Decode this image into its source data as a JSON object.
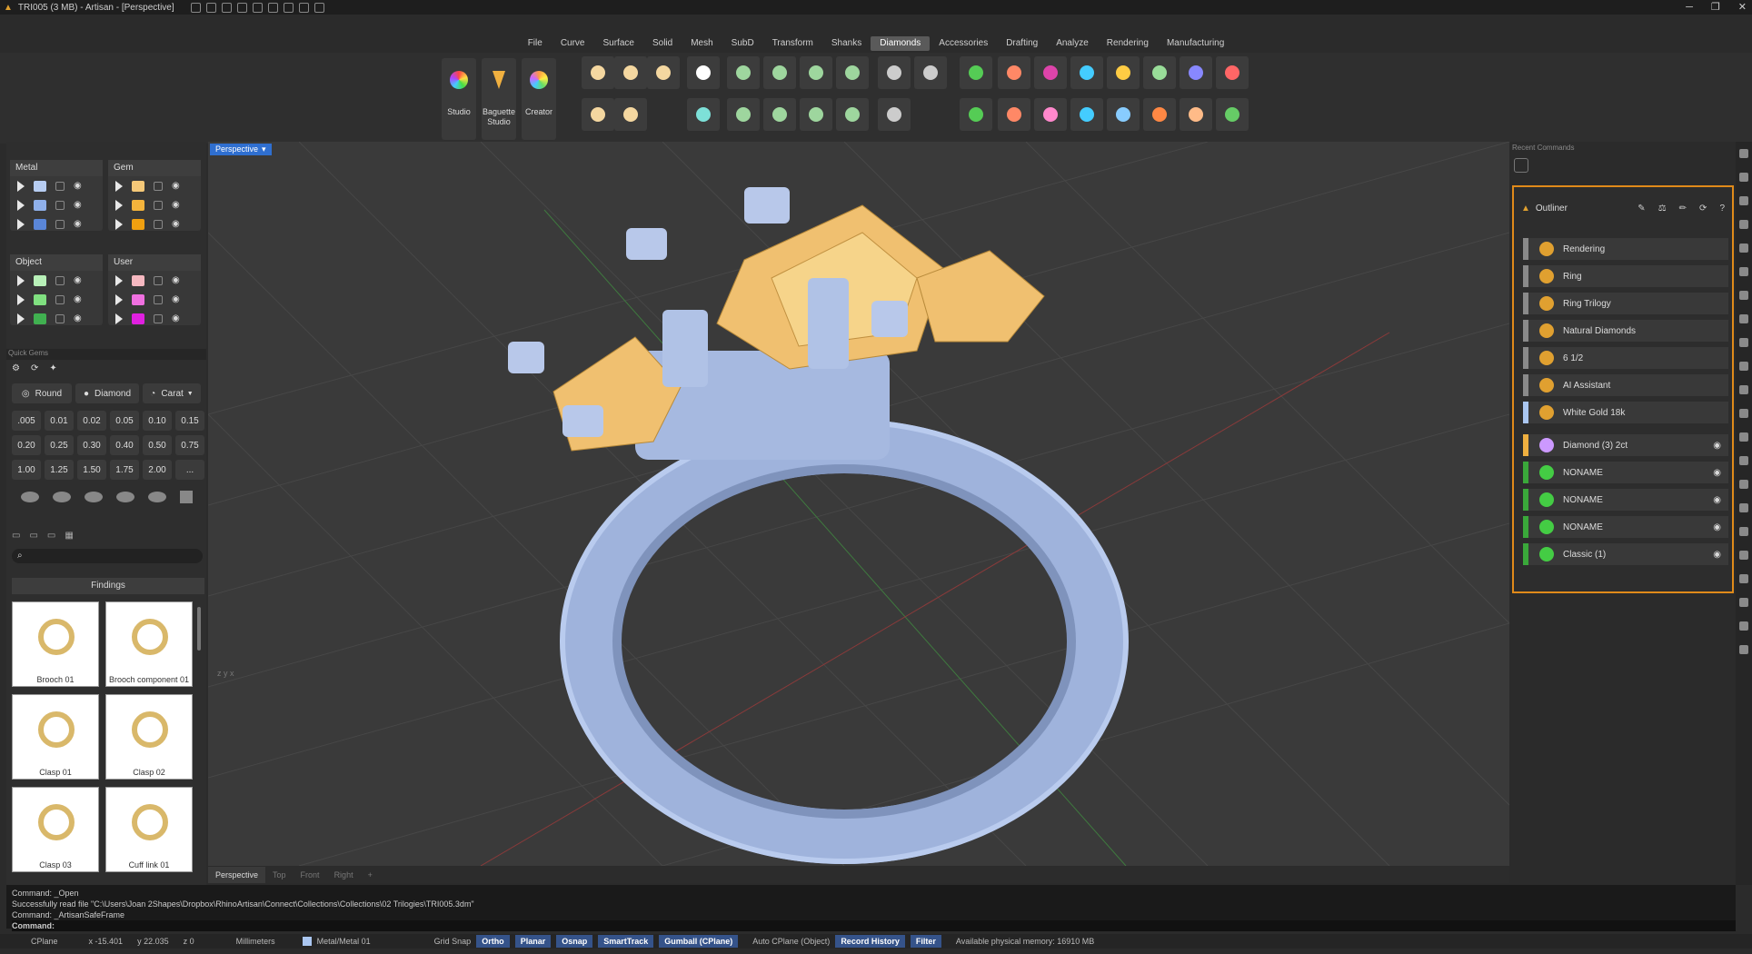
{
  "window": {
    "title": "TRI005 (3 MB) - Artisan - [Perspective]",
    "controls": [
      "─",
      "❐",
      "✕"
    ]
  },
  "menu": [
    {
      "label": "File"
    },
    {
      "label": "Curve"
    },
    {
      "label": "Surface"
    },
    {
      "label": "Solid"
    },
    {
      "label": "Mesh"
    },
    {
      "label": "SubD"
    },
    {
      "label": "Transform"
    },
    {
      "label": "Shanks"
    },
    {
      "label": "Diamonds",
      "active": true
    },
    {
      "label": "Accessories"
    },
    {
      "label": "Drafting"
    },
    {
      "label": "Analyze"
    },
    {
      "label": "Rendering"
    },
    {
      "label": "Manufacturing"
    }
  ],
  "ribbon": {
    "studio": "Studio",
    "baguette": "Baguette Studio",
    "creator": "Creator"
  },
  "left": {
    "layers": {
      "metal": "Metal",
      "gem": "Gem",
      "object": "Object",
      "user": "User"
    },
    "quick_gems": {
      "title": "Quick Gems",
      "round": "Round",
      "diamond": "Diamond",
      "carat": "Carat",
      "sizes": [
        ".005",
        "0.01",
        "0.02",
        "0.05",
        "0.10",
        "0.15",
        "0.20",
        "0.25",
        "0.30",
        "0.40",
        "0.50",
        "0.75",
        "1.00",
        "1.25",
        "1.50",
        "1.75",
        "2.00",
        "..."
      ]
    },
    "catalog": {
      "search_placeholder": "",
      "category": "Findings",
      "items": [
        "Brooch 01",
        "Brooch component 01",
        "Clasp 01",
        "Clasp 02",
        "Clasp 03",
        "Cuff link 01"
      ]
    }
  },
  "viewport": {
    "label": "Perspective",
    "tabs": [
      "Perspective",
      "Top",
      "Front",
      "Right",
      "+"
    ]
  },
  "right": {
    "recent_title": "Recent Commands",
    "outliner_title": "Outliner",
    "items": [
      {
        "label": "Rendering",
        "bar": "#8a8a8a"
      },
      {
        "label": "Ring",
        "bar": "#8a8a8a"
      },
      {
        "label": "Ring Trilogy",
        "bar": "#8a8a8a"
      },
      {
        "label": "Natural Diamonds",
        "bar": "#8a8a8a"
      },
      {
        "label": "6 1/2",
        "bar": "#8a8a8a"
      },
      {
        "label": "AI Assistant",
        "bar": "#8a8a8a"
      },
      {
        "label": "White Gold 18k",
        "bar": "#aac6f0"
      },
      {
        "label": "Diamond (3) 2ct",
        "bar": "#f0b040"
      },
      {
        "label": "NONAME",
        "bar": "#3aa83a"
      },
      {
        "label": "NONAME",
        "bar": "#3aa83a"
      },
      {
        "label": "NONAME",
        "bar": "#3aa83a"
      },
      {
        "label": "Classic (1)",
        "bar": "#3aa83a"
      }
    ]
  },
  "command": {
    "lines": [
      "Command: _Open",
      "Successfully read file \"C:\\Users\\Joan 2Shapes\\Dropbox\\RhinoArtisan\\Connect\\Collections\\Collections\\02 Trilogies\\TRI005.3dm\"",
      "Command: _ArtisanSafeFrame"
    ],
    "prompt": "Command:"
  },
  "status": {
    "cplane": "CPlane",
    "x": "x -15.401",
    "y": "y 22.035",
    "z": "z 0",
    "units": "Millimeters",
    "layer": "Metal/Metal 01",
    "grid": "Grid Snap",
    "ortho": "Ortho",
    "planar": "Planar",
    "osnap": "Osnap",
    "smarttrack": "SmartTrack",
    "gumball": "Gumball (CPlane)",
    "autocplane": "Auto CPlane (Object)",
    "history": "Record History",
    "filter": "Filter",
    "memory": "Available physical memory: 16910 MB"
  },
  "colors": {
    "accent": "#e08a1a",
    "metal": "#aabde0",
    "gold": "#f0c070"
  }
}
